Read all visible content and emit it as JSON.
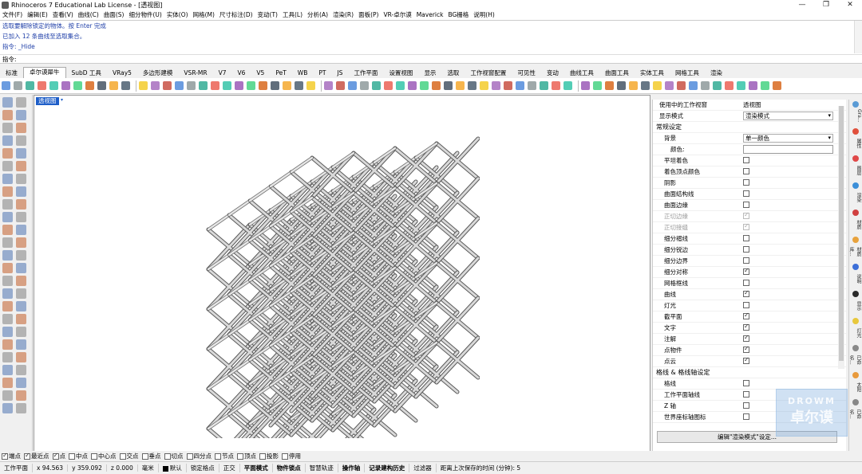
{
  "window": {
    "title": "Rhinoceros 7 Educational Lab License - [透视图]",
    "min": "—",
    "max": "❐",
    "close": "✕"
  },
  "menu": [
    "文件(F)",
    "编辑(E)",
    "查看(V)",
    "曲线(C)",
    "曲面(S)",
    "细分物件(U)",
    "实体(O)",
    "网格(M)",
    "尺寸标注(D)",
    "变动(T)",
    "工具(L)",
    "分析(A)",
    "渲染(R)",
    "面板(P)",
    "VR-卓尔谟",
    "Maverick",
    "BG栅格",
    "说明(H)"
  ],
  "command_history": [
    "选取要解除锁定的物体。按 Enter 完成",
    "已加入 12 条曲线至选取集合。",
    "指令: _Hide"
  ],
  "command_prompt": "指令:",
  "tabs": [
    "标准",
    "卓尔谟犀牛",
    "SubD 工具",
    "VRay5",
    "多边形建模",
    "VSR-MR",
    "V7",
    "V6",
    "V5",
    "PeT",
    "WB",
    "PT",
    "JS",
    "工作平面",
    "设置视图",
    "显示",
    "选取",
    "工作视窗配置",
    "可见性",
    "变动",
    "曲线工具",
    "曲面工具",
    "实体工具",
    "网格工具",
    "渲染"
  ],
  "active_tab": "卓尔谟犀牛",
  "viewport": {
    "label": "透视图",
    "arrow": "▾"
  },
  "panel": {
    "viewport_in_use_label": "使用中的工作视窗",
    "viewport_in_use_value": "透视图",
    "display_mode_label": "显示模式",
    "display_mode_value": "渲染模式",
    "general_section": "常规设定",
    "background_label": "背景",
    "background_value": "单一颜色",
    "color_label": "颜色:",
    "options": [
      {
        "label": "平坦着色",
        "checked": false,
        "disabled": false
      },
      {
        "label": "着色顶点颜色",
        "checked": false,
        "disabled": false
      },
      {
        "label": "阴影",
        "checked": false,
        "disabled": false
      },
      {
        "label": "曲面结构线",
        "checked": false,
        "disabled": false
      },
      {
        "label": "曲面边缘",
        "checked": false,
        "disabled": false
      },
      {
        "label": "正切边缘",
        "checked": true,
        "disabled": true
      },
      {
        "label": "正切接缝",
        "checked": true,
        "disabled": true
      },
      {
        "label": "细分褶线",
        "checked": false,
        "disabled": false
      },
      {
        "label": "细分锐边",
        "checked": false,
        "disabled": false
      },
      {
        "label": "细分边界",
        "checked": false,
        "disabled": false
      },
      {
        "label": "细分对称",
        "checked": true,
        "disabled": false
      },
      {
        "label": "网格框线",
        "checked": false,
        "disabled": false
      },
      {
        "label": "曲线",
        "checked": true,
        "disabled": false
      },
      {
        "label": "灯光",
        "checked": false,
        "disabled": false
      },
      {
        "label": "截平面",
        "checked": true,
        "disabled": false
      },
      {
        "label": "文字",
        "checked": true,
        "disabled": false
      },
      {
        "label": "注解",
        "checked": true,
        "disabled": false
      },
      {
        "label": "点物件",
        "checked": true,
        "disabled": false
      },
      {
        "label": "点云",
        "checked": true,
        "disabled": false
      }
    ],
    "grid_section": "格线 & 格线轴设定",
    "grid_options": [
      {
        "label": "格线",
        "checked": false
      },
      {
        "label": "工作平面轴线",
        "checked": false
      },
      {
        "label": "Z 轴",
        "checked": false
      },
      {
        "label": "世界座标轴图标",
        "checked": false
      }
    ],
    "edit_button": "编辑\"渲染模式\"设定..."
  },
  "side_tabs": [
    {
      "label": "Gra...",
      "color": "#5a9bd5"
    },
    {
      "label": "属性",
      "color": "#e0503c"
    },
    {
      "label": "图层",
      "color": "#e04848"
    },
    {
      "label": "渲染",
      "color": "#3c8fd8"
    },
    {
      "label": "材质",
      "color": "#d04040"
    },
    {
      "label": "材质库...",
      "color": "#e8a23c"
    },
    {
      "label": "说明",
      "color": "#3c6fd8"
    },
    {
      "label": "显示",
      "color": "#2a2a2a"
    },
    {
      "label": "灯光",
      "color": "#e8c83c"
    },
    {
      "label": "已命名...",
      "color": "#888888"
    },
    {
      "label": "太阳",
      "color": "#e89a3c"
    },
    {
      "label": "已命名...",
      "color": "#888888"
    }
  ],
  "osnap": [
    {
      "label": "端点",
      "checked": true
    },
    {
      "label": "最近点",
      "checked": true
    },
    {
      "label": "点",
      "checked": true
    },
    {
      "label": "中点",
      "checked": false
    },
    {
      "label": "中心点",
      "checked": false
    },
    {
      "label": "交点",
      "checked": false
    },
    {
      "label": "垂点",
      "checked": false
    },
    {
      "label": "切点",
      "checked": false
    },
    {
      "label": "四分点",
      "checked": false
    },
    {
      "label": "节点",
      "checked": false
    },
    {
      "label": "顶点",
      "checked": false
    },
    {
      "label": "投影",
      "checked": false
    },
    {
      "label": "停用",
      "checked": false
    }
  ],
  "status": {
    "cplane": "工作平面",
    "x": "x 94.563",
    "y": "y 359.092",
    "z": "z 0.000",
    "unit": "毫米",
    "layer": "默认",
    "lock_grid": "锁定格点",
    "ortho": "正交",
    "planar": "平面模式",
    "osnap": "物件锁点",
    "smarttrack": "智慧轨迹",
    "gumball": "操作轴",
    "history": "记录建构历史",
    "filter": "过滤器",
    "autosave": "距离上次保存的时间 (分钟): 5"
  },
  "watermark": {
    "top": "DROWM",
    "bottom": "卓尔谟"
  }
}
